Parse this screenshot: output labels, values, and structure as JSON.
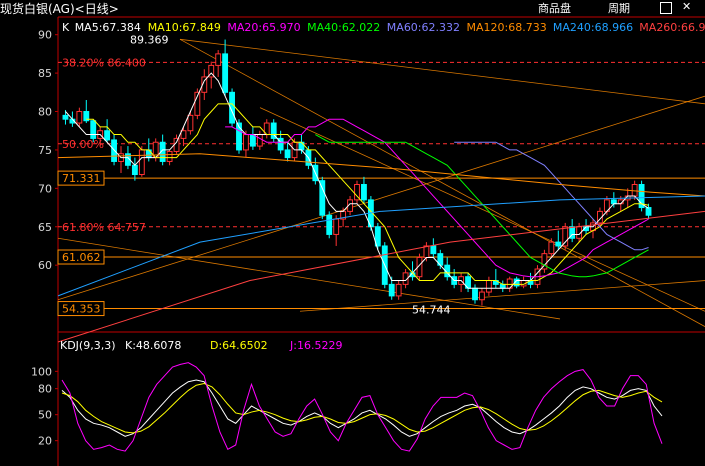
{
  "window_title": "现货白银(AG)<日线>",
  "buttons": {
    "product": "商品盘",
    "period": "周期"
  },
  "ma_legend": [
    {
      "label": "K",
      "color": "#ffffff"
    },
    {
      "label": "MA5:67.384",
      "color": "#ffffff"
    },
    {
      "label": "MA10:67.849",
      "color": "#ffff00"
    },
    {
      "label": "MA20:65.970",
      "color": "#ff00ff"
    },
    {
      "label": "MA40:62.022",
      "color": "#00ff00"
    },
    {
      "label": "MA60:62.332",
      "color": "#8080ff"
    },
    {
      "label": "MA120:68.733",
      "color": "#ff8c00"
    },
    {
      "label": "MA240:68.966",
      "color": "#20a0ff"
    },
    {
      "label": "MA260:66.96",
      "color": "#ff4040"
    }
  ],
  "kdj_legend": [
    {
      "label": "KDJ(9,3,3)",
      "color": "#ffffff"
    },
    {
      "label": "K:48.6078",
      "color": "#ffffff"
    },
    {
      "label": "D:64.6502",
      "color": "#ffff00"
    },
    {
      "label": "J:16.5229",
      "color": "#ff00ff"
    }
  ],
  "price_boxes": [
    "71.331",
    "61.062",
    "54.353"
  ],
  "annotations": {
    "high": "89.369",
    "low": "54.744",
    "fib_382": "38.20% 86.400",
    "fib_500": "50.00%",
    "fib_618": "61.80% 64.757"
  },
  "colors": {
    "up": "#ff3232",
    "down": "#00ffff",
    "axis": "#c00000",
    "fib": "#ff3030",
    "hline": "#ff8c00"
  },
  "chart_data": [
    {
      "type": "candlestick",
      "title": "现货白银(AG)<日线>",
      "ylim": [
        50,
        91
      ],
      "y_ticks": [
        60,
        65,
        70,
        75,
        80,
        85,
        90
      ],
      "grid": false,
      "candles_ohlc": [
        [
          79.5,
          80.2,
          78.3,
          79.0
        ],
        [
          79.0,
          80.0,
          78.0,
          78.5
        ],
        [
          78.5,
          80.5,
          78.0,
          80.0
        ],
        [
          80.0,
          81.5,
          78.5,
          78.8
        ],
        [
          78.8,
          79.0,
          76.0,
          76.5
        ],
        [
          76.5,
          78.0,
          75.5,
          77.5
        ],
        [
          77.5,
          79.0,
          76.0,
          76.3
        ],
        [
          76.3,
          77.0,
          73.0,
          73.5
        ],
        [
          73.5,
          75.5,
          72.0,
          74.5
        ],
        [
          74.5,
          75.5,
          72.5,
          73.0
        ],
        [
          73.0,
          74.0,
          71.0,
          71.8
        ],
        [
          71.8,
          75.5,
          71.5,
          75.0
        ],
        [
          75.0,
          76.5,
          73.5,
          74.0
        ],
        [
          74.0,
          76.5,
          73.5,
          76.0
        ],
        [
          76.0,
          77.0,
          73.0,
          73.5
        ],
        [
          73.5,
          75.0,
          73.0,
          74.8
        ],
        [
          74.8,
          77.0,
          74.5,
          76.5
        ],
        [
          76.5,
          78.0,
          75.5,
          77.5
        ],
        [
          77.5,
          80.0,
          77.0,
          79.5
        ],
        [
          79.5,
          83.0,
          79.0,
          82.5
        ],
        [
          82.5,
          85.5,
          81.5,
          84.5
        ],
        [
          84.5,
          86.5,
          83.0,
          86.0
        ],
        [
          86.0,
          88.0,
          84.5,
          87.5
        ],
        [
          87.5,
          89.369,
          82.0,
          82.5
        ],
        [
          82.5,
          83.0,
          78.0,
          78.5
        ],
        [
          78.5,
          79.0,
          74.5,
          75.0
        ],
        [
          75.0,
          77.5,
          74.0,
          77.0
        ],
        [
          77.0,
          78.0,
          75.0,
          75.5
        ],
        [
          75.5,
          77.5,
          75.0,
          77.0
        ],
        [
          77.0,
          79.0,
          76.5,
          78.5
        ],
        [
          78.5,
          79.0,
          76.0,
          76.5
        ],
        [
          76.5,
          77.5,
          74.5,
          75.0
        ],
        [
          75.0,
          76.0,
          73.5,
          74.0
        ],
        [
          74.0,
          76.5,
          73.5,
          76.0
        ],
        [
          76.0,
          77.0,
          74.5,
          75.0
        ],
        [
          75.0,
          75.5,
          72.5,
          73.0
        ],
        [
          73.0,
          74.0,
          70.5,
          71.0
        ],
        [
          71.0,
          71.5,
          66.0,
          66.5
        ],
        [
          66.5,
          67.0,
          63.5,
          64.0
        ],
        [
          64.0,
          66.5,
          62.5,
          66.0
        ],
        [
          66.0,
          67.5,
          65.0,
          67.0
        ],
        [
          67.0,
          69.0,
          66.5,
          68.5
        ],
        [
          68.5,
          71.0,
          68.0,
          70.5
        ],
        [
          70.5,
          71.5,
          68.0,
          68.5
        ],
        [
          68.5,
          69.0,
          64.5,
          65.0
        ],
        [
          65.0,
          65.5,
          62.0,
          62.5
        ],
        [
          62.5,
          63.0,
          57.0,
          57.5
        ],
        [
          57.5,
          58.5,
          55.5,
          56.0
        ],
        [
          56.0,
          58.0,
          55.5,
          57.5
        ],
        [
          57.5,
          59.5,
          57.0,
          59.0
        ],
        [
          59.0,
          60.5,
          58.0,
          58.5
        ],
        [
          58.5,
          61.5,
          58.0,
          61.0
        ],
        [
          61.0,
          63.0,
          60.5,
          62.5
        ],
        [
          62.5,
          63.5,
          61.0,
          61.5
        ],
        [
          61.5,
          62.0,
          59.5,
          60.0
        ],
        [
          60.0,
          61.0,
          58.0,
          58.5
        ],
        [
          58.5,
          59.5,
          57.0,
          57.5
        ],
        [
          57.5,
          59.0,
          56.5,
          58.5
        ],
        [
          58.5,
          59.0,
          56.5,
          57.0
        ],
        [
          57.0,
          57.5,
          55.0,
          55.5
        ],
        [
          55.5,
          57.0,
          54.744,
          56.5
        ],
        [
          56.5,
          58.5,
          56.0,
          58.0
        ],
        [
          58.0,
          59.5,
          57.0,
          57.5
        ],
        [
          57.5,
          58.0,
          56.5,
          57.0
        ],
        [
          57.0,
          58.5,
          56.5,
          58.2
        ],
        [
          58.2,
          58.5,
          57.0,
          57.3
        ],
        [
          57.3,
          58.5,
          57.0,
          58.0
        ],
        [
          58.0,
          59.0,
          57.0,
          57.5
        ],
        [
          57.5,
          60.0,
          57.0,
          59.5
        ],
        [
          59.5,
          62.0,
          59.0,
          61.5
        ],
        [
          61.5,
          63.5,
          61.0,
          63.0
        ],
        [
          63.0,
          64.5,
          62.0,
          62.5
        ],
        [
          62.5,
          65.5,
          62.0,
          65.0
        ],
        [
          65.0,
          66.0,
          63.0,
          63.5
        ],
        [
          63.5,
          65.5,
          63.0,
          65.0
        ],
        [
          65.0,
          66.0,
          64.0,
          64.5
        ],
        [
          64.5,
          66.0,
          63.5,
          65.5
        ],
        [
          65.5,
          67.5,
          65.0,
          67.0
        ],
        [
          67.0,
          69.0,
          66.5,
          68.5
        ],
        [
          68.5,
          69.5,
          67.5,
          68.0
        ],
        [
          68.0,
          69.0,
          67.0,
          68.5
        ],
        [
          68.5,
          70.0,
          67.5,
          69.0
        ],
        [
          69.0,
          71.0,
          68.5,
          70.5
        ],
        [
          70.5,
          71.0,
          67.0,
          67.5
        ],
        [
          67.5,
          68.0,
          66.0,
          66.5
        ]
      ],
      "ma_lines": {
        "MA5": [
          80,
          79,
          78,
          77,
          77,
          77,
          76,
          75,
          74,
          74,
          73,
          74,
          74,
          74,
          75,
          75,
          76,
          78,
          80,
          82,
          84,
          85,
          84,
          82,
          80,
          78,
          77,
          77,
          77,
          77,
          77,
          76,
          76,
          75,
          75,
          74,
          72,
          70,
          68,
          67,
          67,
          68,
          68,
          67,
          65,
          62,
          60,
          58,
          58,
          58,
          59,
          60,
          61,
          61,
          60,
          59,
          58,
          58,
          57,
          57,
          57,
          57,
          57,
          57,
          57,
          58,
          58,
          58,
          59,
          60,
          61,
          62,
          63,
          64,
          64,
          65,
          65,
          66,
          67,
          68,
          68,
          69,
          69,
          68,
          67.4
        ],
        "MA10": [
          79,
          79,
          78,
          78,
          77,
          77,
          76,
          76,
          75,
          75,
          74,
          74,
          74,
          74,
          75,
          76,
          77,
          79,
          80,
          81,
          81,
          81,
          80,
          79,
          78,
          78,
          77,
          77,
          77,
          77,
          76,
          76,
          75,
          75,
          74,
          73,
          72,
          71,
          70,
          69,
          68,
          67,
          66,
          65,
          63,
          61,
          60,
          59,
          58,
          58,
          58,
          59,
          59,
          59,
          59,
          59,
          58,
          58,
          58,
          58,
          57.5,
          57.5,
          57.5,
          57.5,
          58,
          58,
          58.5,
          59,
          60,
          61,
          62,
          63,
          64,
          64.5,
          65,
          66,
          66.5,
          67,
          67.5,
          68,
          68,
          67.8
        ],
        "MA20": [
          78,
          78,
          77.5,
          77,
          77,
          76.5,
          76,
          76,
          76,
          76,
          77,
          77,
          78,
          78,
          78.5,
          79,
          79,
          79,
          78.5,
          78,
          77.5,
          77,
          76.5,
          76,
          75,
          74,
          73,
          72,
          71,
          70,
          69,
          68,
          67,
          66,
          65,
          64,
          63,
          62,
          61,
          60,
          59.5,
          59,
          58.8,
          58.6,
          58.5,
          58.5,
          58.6,
          58.8,
          59,
          59.5,
          60,
          60.5,
          61,
          62,
          62.5,
          63,
          63.5,
          64,
          64.5,
          65,
          65.5,
          66
        ],
        "MA40": [
          77,
          76.5,
          76,
          76,
          76,
          76,
          76,
          76,
          76,
          76,
          76,
          76,
          76,
          76,
          75.5,
          75,
          74.5,
          74,
          73.5,
          73,
          72,
          71,
          70,
          69,
          68,
          67,
          66,
          65,
          64,
          63,
          62,
          61,
          60.5,
          60,
          59.5,
          59,
          58.8,
          58.6,
          58.5,
          58.5,
          58.6,
          58.8,
          59,
          59.5,
          60,
          60.5,
          61,
          61.5,
          62
        ],
        "MA60": [
          76,
          76,
          76,
          76,
          76,
          76,
          76,
          75.5,
          75,
          75,
          74.5,
          74,
          73.5,
          73,
          72,
          71,
          70,
          69,
          68,
          67,
          66,
          65,
          64,
          63.5,
          63,
          62.5,
          62,
          62,
          62.3
        ]
      }
    },
    {
      "type": "line",
      "title": "KDJ(9,3,3)",
      "ylim": [
        0,
        120
      ],
      "y_ticks": [
        20,
        50,
        80,
        100
      ],
      "series": [
        {
          "name": "K",
          "values": [
            78,
            70,
            55,
            45,
            40,
            38,
            35,
            30,
            25,
            28,
            35,
            45,
            55,
            65,
            75,
            82,
            88,
            90,
            88,
            75,
            60,
            45,
            40,
            50,
            60,
            55,
            50,
            45,
            40,
            38,
            42,
            48,
            52,
            48,
            40,
            35,
            40,
            45,
            52,
            55,
            50,
            45,
            38,
            30,
            25,
            28,
            35,
            42,
            48,
            52,
            55,
            60,
            62,
            58,
            50,
            42,
            35,
            30,
            28,
            32,
            38,
            45,
            52,
            60,
            70,
            78,
            82,
            80,
            75,
            70,
            68,
            72,
            78,
            80,
            78,
            60,
            48.6
          ]
        },
        {
          "name": "D",
          "values": [
            75,
            72,
            65,
            55,
            48,
            42,
            38,
            34,
            30,
            29,
            31,
            36,
            44,
            52,
            61,
            70,
            78,
            84,
            86,
            82,
            73,
            62,
            52,
            50,
            53,
            55,
            53,
            50,
            46,
            43,
            42,
            44,
            47,
            48,
            45,
            41,
            40,
            42,
            46,
            50,
            51,
            49,
            45,
            39,
            33,
            30,
            31,
            35,
            40,
            45,
            50,
            55,
            58,
            59,
            56,
            51,
            45,
            39,
            34,
            32,
            33,
            37,
            43,
            50,
            58,
            66,
            73,
            77,
            78,
            75,
            72,
            70,
            72,
            75,
            77,
            70,
            64.7
          ]
        },
        {
          "name": "J",
          "values": [
            90,
            75,
            40,
            20,
            10,
            12,
            15,
            10,
            8,
            20,
            45,
            70,
            85,
            95,
            105,
            108,
            110,
            105,
            95,
            60,
            30,
            10,
            15,
            55,
            85,
            60,
            45,
            30,
            25,
            28,
            45,
            60,
            68,
            50,
            30,
            20,
            40,
            55,
            70,
            72,
            50,
            35,
            20,
            10,
            8,
            22,
            45,
            60,
            70,
            70,
            70,
            75,
            72,
            55,
            35,
            20,
            15,
            10,
            12,
            35,
            55,
            70,
            80,
            88,
            95,
            100,
            102,
            90,
            70,
            60,
            60,
            80,
            95,
            95,
            85,
            40,
            16.5
          ]
        }
      ]
    }
  ]
}
